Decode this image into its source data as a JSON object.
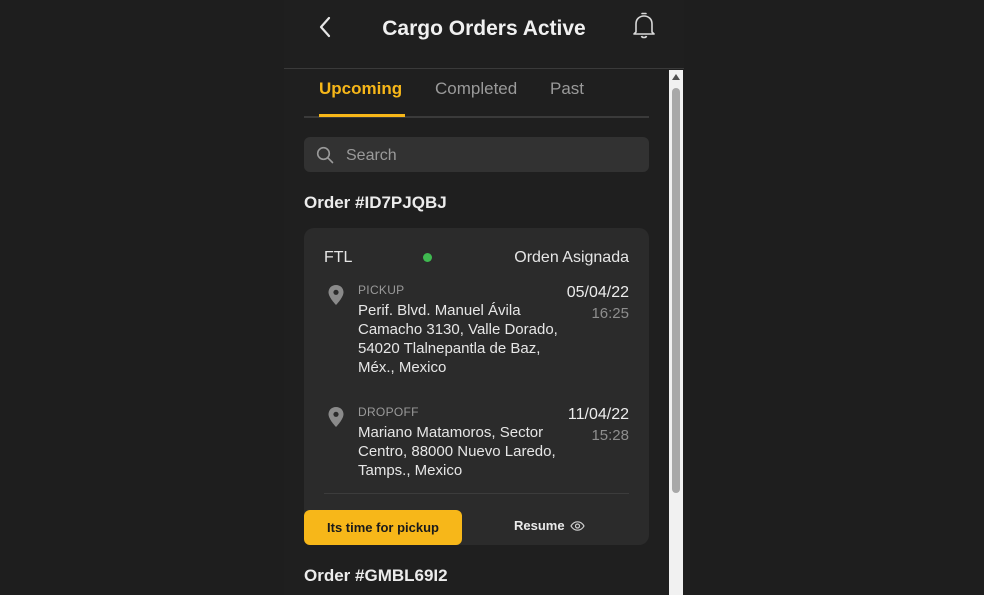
{
  "header": {
    "title": "Cargo Orders Active"
  },
  "tabs": [
    {
      "label": "Upcoming",
      "active": true
    },
    {
      "label": "Completed",
      "active": false
    },
    {
      "label": "Past",
      "active": false
    }
  ],
  "search": {
    "placeholder": "Search",
    "value": ""
  },
  "orders": [
    {
      "heading": "Order #ID7PJQBJ",
      "type": "FTL",
      "status": "Orden Asignada",
      "status_color": "#3fb950",
      "pickup": {
        "label": "PICKUP",
        "address": "Perif. Blvd. Manuel Ávila Camacho 3130, Valle Dorado, 54020 Tlalnepantla de Baz, Méx., Mexico",
        "date": "05/04/22",
        "time": "16:25"
      },
      "dropoff": {
        "label": "DROPOFF",
        "address": "Mariano Matamoros, Sector Centro, 88000 Nuevo Laredo, Tamps., Mexico",
        "date": "11/04/22",
        "time": "15:28"
      },
      "primary_action": "Its time for pickup",
      "secondary_action": "Resume"
    },
    {
      "heading": "Order #GMBL69I2"
    }
  ],
  "colors": {
    "accent": "#f7b719",
    "background": "#1f1f1f",
    "card": "#2b2b2b"
  },
  "icons": [
    "back-arrow-icon",
    "bell-icon",
    "search-icon",
    "map-pin-icon",
    "eye-icon"
  ]
}
